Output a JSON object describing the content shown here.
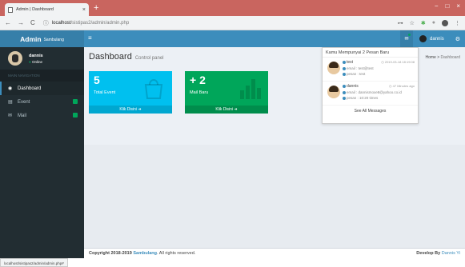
{
  "browser": {
    "tab_title": "Admin | Dashboard",
    "tab_close": "×",
    "new_tab": "+",
    "win_min": "−",
    "win_max": "□",
    "win_close": "×",
    "back": "←",
    "forward": "→",
    "reload": "C",
    "info": "ⓘ",
    "url_host": "localhost",
    "url_path": "/sistipas2/admin/admin.php",
    "key_icon": "⊶",
    "star_icon": "☆",
    "ext_icon": "✱",
    "ext2_icon": "●",
    "menu_icon": "⋮"
  },
  "header": {
    "logo_bold": "Admin",
    "logo_small": "Sambulang",
    "hamburger": "≡",
    "bell": "✉",
    "user_name": "dannis",
    "gear": "⚙"
  },
  "sidebar": {
    "user_name": "dannis",
    "status_dot": "●",
    "status": "Online",
    "nav_header": "MAIN NAVIGATION",
    "items": [
      {
        "icon": "◉",
        "label": "Dashboard"
      },
      {
        "icon": "▤",
        "label": "Event"
      },
      {
        "icon": "✉",
        "label": "Mail"
      }
    ]
  },
  "content": {
    "title": "Dashboard",
    "subtitle": "Control panel",
    "breadcrumb_home": "Home",
    "breadcrumb_sep": ">",
    "breadcrumb_current": "Dashboard",
    "boxes": [
      {
        "value": "5",
        "label": "Total Event",
        "footer": "Klik Disini ➜"
      },
      {
        "value": "+ 2",
        "label": "Mail Baru",
        "footer": "Klik Disini ➜"
      }
    ]
  },
  "dropdown": {
    "header": "Kamu Mempunyai 2 Pesan Baru",
    "messages": [
      {
        "name": "test",
        "time": "◷ 2019-03-18 18:19:08",
        "email": "email : test@test",
        "pesan": "pesan : test"
      },
      {
        "name": "dannis",
        "time": "◷ 47 Minutes ago",
        "email": "email : dannismoxe8@yahoo.co.id",
        "pesan": "pesan : 10:20 times"
      }
    ],
    "footer": "See All Messages"
  },
  "footer": {
    "copyright_prefix": "Copyright 2018-2019",
    "brand": "Sambulang",
    "rights": ". All rights reserved.",
    "dev_prefix": "Develop By",
    "dev_name": "Dannis Yi"
  },
  "statusbar": {
    "url": "localhost/sistipas2/admin/admin.php#"
  },
  "colors": {
    "header": "#3c8dbc",
    "sidebar": "#222d32",
    "aqua": "#00c0ef",
    "green": "#00a65a",
    "titlebar": "#c9655f"
  }
}
